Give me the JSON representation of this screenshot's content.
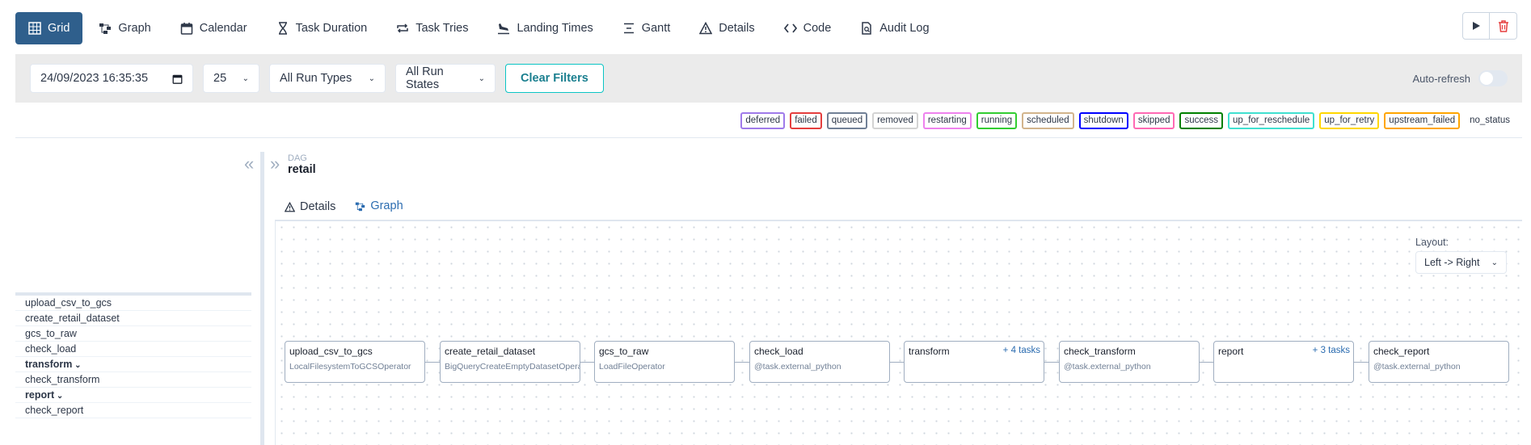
{
  "nav": {
    "items": [
      {
        "label": "Grid",
        "icon": "grid-icon",
        "active": true
      },
      {
        "label": "Graph",
        "icon": "graph-icon"
      },
      {
        "label": "Calendar",
        "icon": "calendar-icon"
      },
      {
        "label": "Task Duration",
        "icon": "hourglass-icon"
      },
      {
        "label": "Task Tries",
        "icon": "repeat-icon"
      },
      {
        "label": "Landing Times",
        "icon": "plane-landing-icon"
      },
      {
        "label": "Gantt",
        "icon": "gantt-icon"
      },
      {
        "label": "Details",
        "icon": "warning-triangle-icon"
      },
      {
        "label": "Code",
        "icon": "code-icon"
      },
      {
        "label": "Audit Log",
        "icon": "file-search-icon"
      }
    ],
    "actions": {
      "trigger_icon": "play-icon",
      "delete_icon": "trash-icon",
      "delete_color": "#e53e3e"
    }
  },
  "filters": {
    "datetime": "24/09/2023 16:35:35",
    "num_runs": "25",
    "run_types": "All Run Types",
    "run_states": "All Run States",
    "clear": "Clear Filters",
    "auto_refresh": "Auto-refresh"
  },
  "legend": [
    {
      "label": "deferred",
      "color": "#9f7aea"
    },
    {
      "label": "failed",
      "color": "#e53e3e"
    },
    {
      "label": "queued",
      "color": "#718096"
    },
    {
      "label": "removed",
      "color": "#d3d3d3"
    },
    {
      "label": "restarting",
      "color": "#ee82ee"
    },
    {
      "label": "running",
      "color": "#32cd32"
    },
    {
      "label": "scheduled",
      "color": "#d2b48c"
    },
    {
      "label": "shutdown",
      "color": "#0000ff"
    },
    {
      "label": "skipped",
      "color": "#ff69b4"
    },
    {
      "label": "success",
      "color": "#008000"
    },
    {
      "label": "up_for_reschedule",
      "color": "#40e0d0"
    },
    {
      "label": "up_for_retry",
      "color": "#ffd700"
    },
    {
      "label": "upstream_failed",
      "color": "#ffa500"
    },
    {
      "label": "no_status",
      "color": ""
    }
  ],
  "tasks": [
    {
      "label": "upload_csv_to_gcs"
    },
    {
      "label": "create_retail_dataset"
    },
    {
      "label": "gcs_to_raw"
    },
    {
      "label": "check_load"
    },
    {
      "label": "transform",
      "group": true
    },
    {
      "label": "check_transform"
    },
    {
      "label": "report",
      "group": true
    },
    {
      "label": "check_report"
    }
  ],
  "dag": {
    "small_label": "DAG",
    "name": "retail"
  },
  "tabs": [
    {
      "label": "Details",
      "icon": "warning-triangle-icon"
    },
    {
      "label": "Graph",
      "icon": "graph-icon",
      "active": true
    }
  ],
  "graph": {
    "layout_label": "Layout:",
    "layout_value": "Left -> Right",
    "nodes": [
      {
        "name": "upload_csv_to_gcs",
        "op": "LocalFilesystemToGCSOperator"
      },
      {
        "name": "create_retail_dataset",
        "op": "BigQueryCreateEmptyDatasetOperator"
      },
      {
        "name": "gcs_to_raw",
        "op": "LoadFileOperator"
      },
      {
        "name": "check_load",
        "op": "@task.external_python"
      },
      {
        "name": "transform",
        "op": "",
        "more": "+ 4 tasks"
      },
      {
        "name": "check_transform",
        "op": "@task.external_python"
      },
      {
        "name": "report",
        "op": "",
        "more": "+ 3 tasks"
      },
      {
        "name": "check_report",
        "op": "@task.external_python"
      }
    ]
  }
}
